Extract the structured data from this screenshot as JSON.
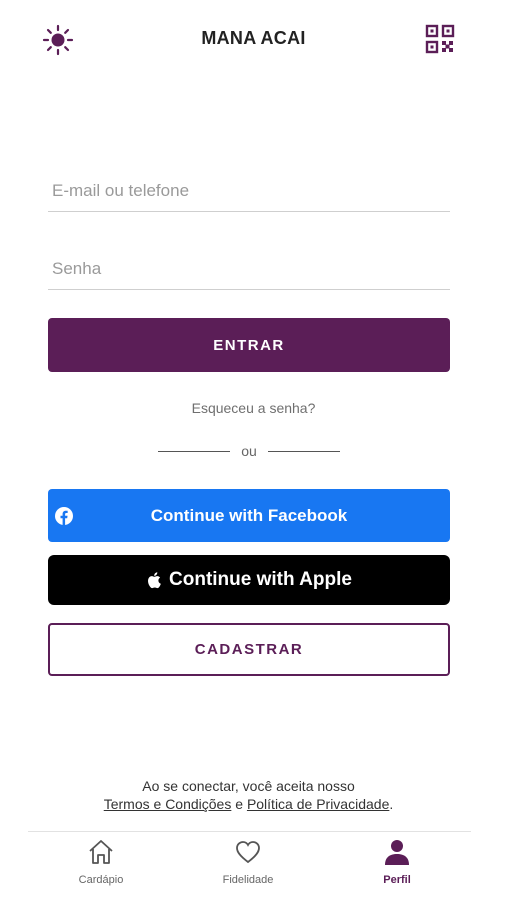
{
  "header": {
    "title": "MANA ACAI",
    "left_icon": "sun-icon",
    "right_icon": "qr-code-icon"
  },
  "login": {
    "email_placeholder": "E-mail ou telefone",
    "password_placeholder": "Senha",
    "submit_label": "ENTRAR",
    "forgot_label": "Esqueceu a senha?",
    "divider_label": "ou"
  },
  "social": {
    "facebook_label": "Continue with Facebook",
    "apple_label": "Continue with Apple"
  },
  "register": {
    "label": "CADASTRAR"
  },
  "legal": {
    "line1": "Ao se conectar, você aceita nosso",
    "terms": "Termos e Condições",
    "conjunction": "e",
    "privacy": "Política de Privacidade",
    "end": "."
  },
  "nav": {
    "items": [
      {
        "label": "Cardápio",
        "icon": "home-icon"
      },
      {
        "label": "Fidelidade",
        "icon": "heart-icon"
      },
      {
        "label": "Perfil",
        "icon": "person-icon",
        "active": true
      }
    ]
  },
  "colors": {
    "brand": "#5b1e57",
    "facebook": "#1877f2",
    "apple": "#000000"
  }
}
